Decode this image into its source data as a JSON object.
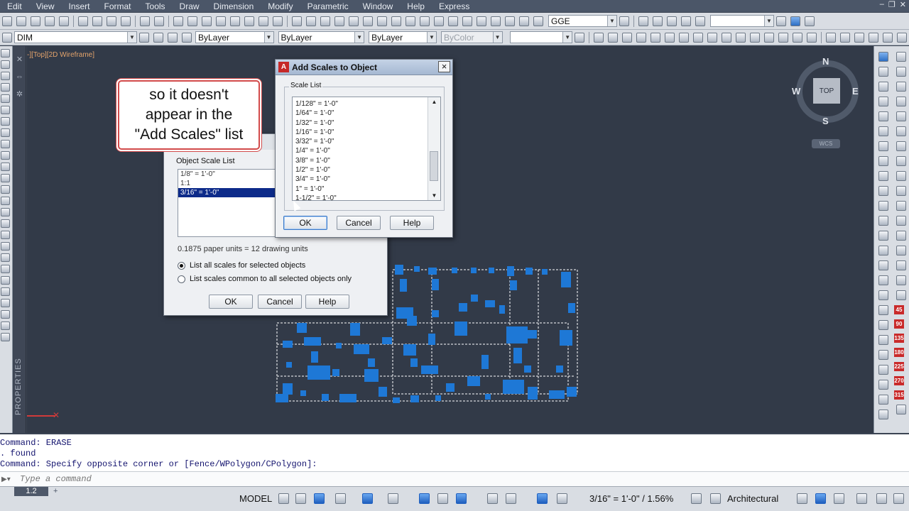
{
  "menu": {
    "items": [
      "Edit",
      "View",
      "Insert",
      "Format",
      "Tools",
      "Draw",
      "Dimension",
      "Modify",
      "Parametric",
      "Window",
      "Help",
      "Express"
    ]
  },
  "toolbars": {
    "text_style": "GGE",
    "dim_style": "DIM",
    "color": "ByLayer",
    "linetype": "ByLayer",
    "lineweight": "ByLayer",
    "plotstyle": "ByColor"
  },
  "drawing": {
    "view_label": "-][Top][2D Wireframe]",
    "palette_title": "PROPERTIES",
    "viewcube": {
      "n": "N",
      "s": "S",
      "e": "E",
      "w": "W",
      "top": "TOP",
      "wcs": "WCS"
    }
  },
  "callout": {
    "text": "so it doesn't\nappear in the\n\"Add Scales\" list"
  },
  "annotation_dialog": {
    "list_label": "Object Scale List",
    "items": [
      "1/8\" = 1'-0\"",
      "1:1",
      "3/16\" = 1'-0\""
    ],
    "selected_index": 2,
    "units_text": "0.1875 paper units = 12 drawing units",
    "radio_all": "List all scales for selected objects",
    "radio_common": "List scales common to all selected objects only",
    "ok": "OK",
    "cancel": "Cancel",
    "help": "Help"
  },
  "add_scales_dialog": {
    "title": "Add Scales to Object",
    "group_label": "Scale List",
    "items": [
      "1/128\" = 1'-0\"",
      "1/64\" = 1'-0\"",
      "1/32\" = 1'-0\"",
      "1/16\" = 1'-0\"",
      "3/32\" = 1'-0\"",
      "1/4\" = 1'-0\"",
      "3/8\" = 1'-0\"",
      "1/2\" = 1'-0\"",
      "3/4\" = 1'-0\"",
      "1\" = 1'-0\"",
      "1-1/2\" = 1'-0\""
    ],
    "ok": "OK",
    "cancel": "Cancel",
    "help": "Help",
    "close": "×"
  },
  "command": {
    "history": [
      "Command: ERASE",
      ". found",
      "Command: Specify opposite corner or [Fence/WPolygon/CPolygon]:"
    ],
    "placeholder": "Type a command"
  },
  "status": {
    "layout_tab": "1.2",
    "add_tab": "+",
    "model": "MODEL",
    "annotation_scale": "3/16\" = 1'-0\" / 1.56%",
    "units": "Architectural"
  },
  "rightstrip_numbers": [
    "45",
    "90",
    "135",
    "180",
    "225",
    "270",
    "315"
  ]
}
